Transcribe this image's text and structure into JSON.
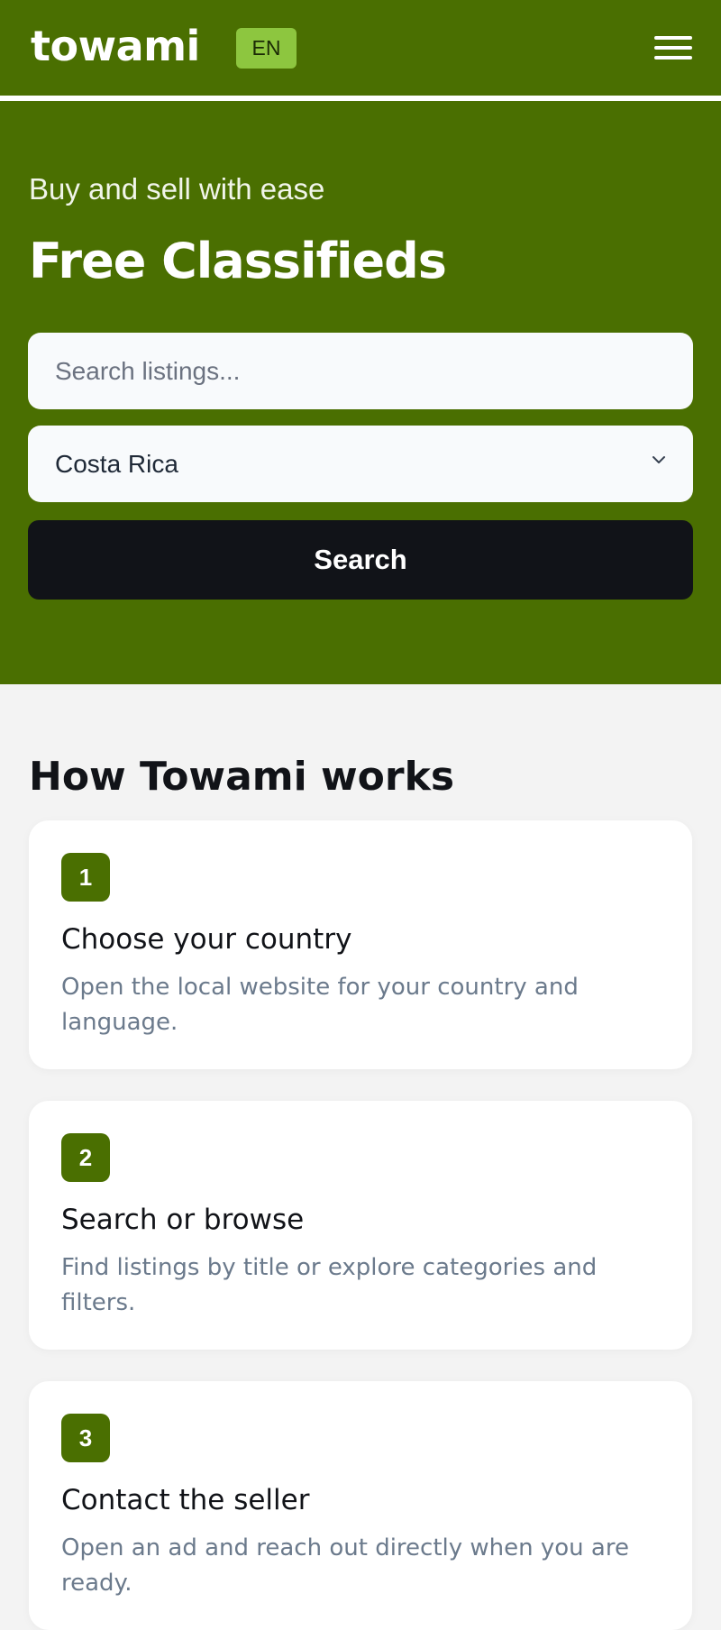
{
  "header": {
    "logo": "towami",
    "language_badge": "EN",
    "menu_icon": "hamburger-menu-icon"
  },
  "hero": {
    "subtitle": "Buy and sell with ease",
    "title": "Free Classifieds",
    "search_placeholder": "Search listings...",
    "country_selected": "Costa Rica",
    "search_button": "Search"
  },
  "how_it_works": {
    "title": "How Towami works",
    "steps": [
      {
        "number": "1",
        "title": "Choose your country",
        "description": "Open the local website for your country and language."
      },
      {
        "number": "2",
        "title": "Search or browse",
        "description": "Find listings by title or explore categories and filters."
      },
      {
        "number": "3",
        "title": "Contact the seller",
        "description": "Open an ad and reach out directly when you are ready."
      }
    ]
  },
  "colors": {
    "brand_green": "#4a6f01",
    "badge_green": "#8dc63f",
    "button_dark": "#111318",
    "page_background": "#f3f3f3"
  }
}
